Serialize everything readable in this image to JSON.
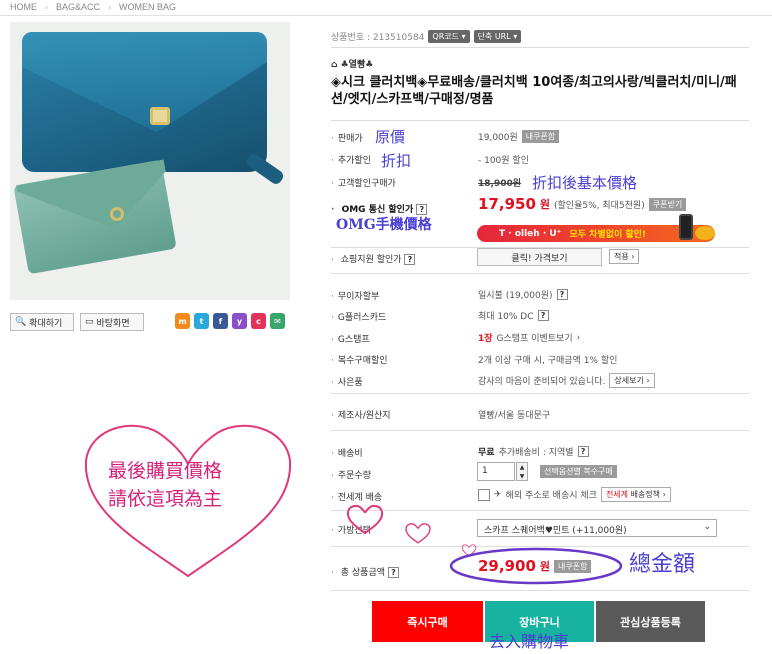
{
  "breadcrumb": [
    "HOME",
    "BAG&ACC",
    "WOMEN BAG"
  ],
  "left": {
    "zoom_label": "확대하기",
    "wallpaper_label": "바탕화면",
    "share_icons": [
      "me2day-icon",
      "twitter-icon",
      "facebook-icon",
      "yozm-icon",
      "cyworld-icon",
      "mail-icon"
    ]
  },
  "product": {
    "code_text": "상품번호 : 213510584",
    "qr_label": "QR코드",
    "short_url_label": "단축 URL",
    "brand": "♣열빵♣",
    "title": "◈시크 클러치백◈무료배송/클러치백 10여종/최고의사랑/빅클러치/미니/패션/엣지/스카프백/구매정/명품"
  },
  "rows": {
    "sale_price": {
      "label": "판매가",
      "value": "19,000원",
      "btn": "내쿠폰함"
    },
    "extra_discount": {
      "label": "추가할인",
      "value": "- 100원 할인"
    },
    "customer_price": {
      "label": "고객할인구매가",
      "value": "18,900원"
    },
    "omg": {
      "label": "OMG 통신 할인가",
      "price": "17,950",
      "unit": "원",
      "note": "(할인율5%, 최대5천원)",
      "btn": "쿠폰받기"
    },
    "olleh_banner": {
      "brand": "T · olleh · U⁺",
      "text": "모두 차별없이 할인!"
    },
    "shopping_support": {
      "label": "쇼핑지원 할인가",
      "btn": "클릭! 가격보기",
      "apply": "적용"
    },
    "interest_free": {
      "label": "무이자할부",
      "value": "일시불 (19,000원)"
    },
    "g_plus": {
      "label": "G플러스카드",
      "value": "최대 10% DC"
    },
    "g_stamp": {
      "label": "G스탬프",
      "count": "1장",
      "value": "G스탬프 이벤트보기"
    },
    "multi_buy": {
      "label": "복수구매할인",
      "value": "2개 이상 구매 시, 구매금액 1% 할인"
    },
    "gift": {
      "label": "사은품",
      "value": "감사의 마음이 준비되어 있습니다.",
      "btn": "상세보기"
    },
    "origin": {
      "label": "제조사/원산지",
      "value": "열빵/서울 동대문구"
    },
    "shipping": {
      "label": "배송비",
      "free": "무료",
      "value": "추가배송비 : 지역별"
    },
    "quantity": {
      "label": "주문수량",
      "value": "1",
      "btn": "선택옵션별 복수구매"
    },
    "global_ship": {
      "label": "전세계 배송",
      "text": "해외 주소로 배송시 체크",
      "red": "전세계",
      "btn": "배송정책"
    },
    "option": {
      "label": "가방선택",
      "value": "스카프 스퀘어백♥민트 (+11,000원)"
    },
    "total": {
      "label": "총 상품금액",
      "price": "29,900",
      "unit": "원",
      "btn": "내쿠폰함"
    }
  },
  "buttons": {
    "buy_now": "즉시구매",
    "cart": "장바구니",
    "wish": "관심상품등록"
  },
  "annotations": {
    "original_price": "原價",
    "discount": "折扣",
    "discounted_base": "折扣後基本價格",
    "omg_mobile": "OMG手機價格",
    "final_note_1": "最後購買價格",
    "final_note_2": "請依這項為主",
    "total_amount": "總金額",
    "to_cart": "去入購物車"
  },
  "colors": {
    "accent_red": "#e01020",
    "annotation_blue": "#4a3fd0",
    "heart_pink": "#e0387a",
    "buy_red": "#ff0000",
    "cart_teal": "#18b3a0",
    "wish_gray": "#5a5a5a"
  }
}
